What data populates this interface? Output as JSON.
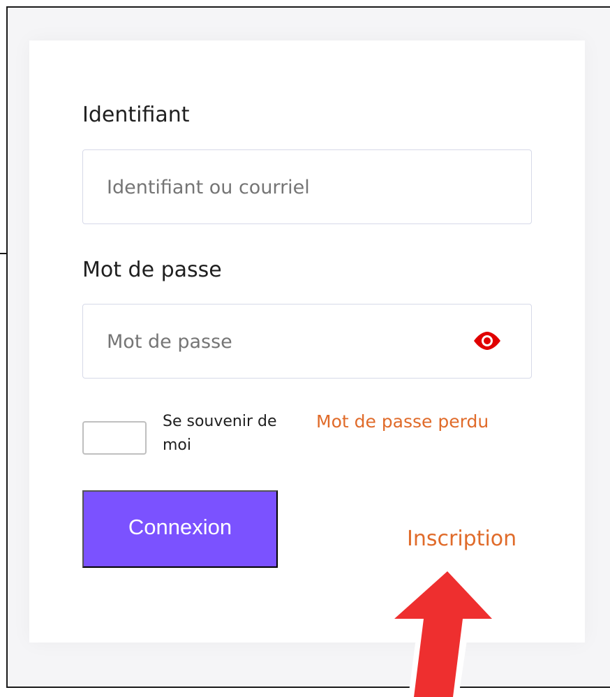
{
  "form": {
    "username_label": "Identifiant",
    "username_placeholder": "Identifiant ou courriel",
    "password_label": "Mot de passe",
    "password_placeholder": "Mot de passe",
    "remember_label": "Se souvenir de moi",
    "lost_password_link": "Mot de passe perdu",
    "login_button": "Connexion",
    "signup_link": "Inscription"
  },
  "icons": {
    "password_toggle": "eye-icon",
    "annotation": "arrow-up-icon"
  },
  "colors": {
    "accent": "#7b52ff",
    "link": "#e06b2a",
    "eye_icon": "#e00000",
    "arrow": "#ee2f2f"
  }
}
